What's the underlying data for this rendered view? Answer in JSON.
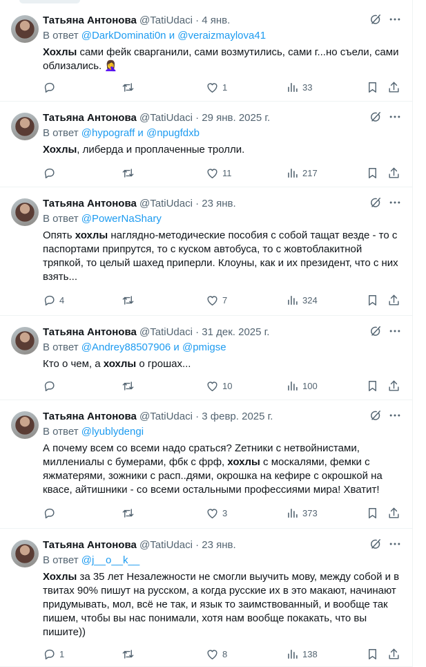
{
  "tweets": [
    {
      "name": "Татьяна Антонова",
      "handle": "@TatiUdaci",
      "dot": "·",
      "date": "4 янв.",
      "reply_prefix": "В ответ",
      "reply_to": [
        "@DarkDominati0n",
        "@veraizmaylova41"
      ],
      "reply_joiner": "и",
      "text_parts": [
        {
          "t": "Хохлы",
          "b": true
        },
        {
          "t": " сами фейк сварганили, сами возмутились, сами г...но съели, сами облизались. 🤦‍♀️",
          "b": false
        }
      ],
      "replies": "",
      "retweets": "",
      "likes": "1",
      "views": "33"
    },
    {
      "name": "Татьяна Антонова",
      "handle": "@TatiUdaci",
      "dot": "·",
      "date": "29 янв. 2025 г.",
      "reply_prefix": "В ответ",
      "reply_to": [
        "@hypograff",
        "@npugfdxb"
      ],
      "reply_joiner": "и",
      "text_parts": [
        {
          "t": "Хохлы",
          "b": true
        },
        {
          "t": ", либерда и проплаченные тролли.",
          "b": false
        }
      ],
      "replies": "",
      "retweets": "",
      "likes": "11",
      "views": "217"
    },
    {
      "name": "Татьяна Антонова",
      "handle": "@TatiUdaci",
      "dot": "·",
      "date": "23 янв.",
      "reply_prefix": "В ответ",
      "reply_to": [
        "@PowerNaShary"
      ],
      "reply_joiner": "",
      "text_parts": [
        {
          "t": "Опять ",
          "b": false
        },
        {
          "t": "хохлы",
          "b": true
        },
        {
          "t": " наглядно-методические пособия с собой тащат везде - то с паспортами припрутся, то с куском автобуса, то с жовтоблакитной тряпкой, то целый шахед приперли. Клоуны, как и их президент, что с них взять...",
          "b": false
        }
      ],
      "replies": "4",
      "retweets": "",
      "likes": "7",
      "views": "324"
    },
    {
      "name": "Татьяна Антонова",
      "handle": "@TatiUdaci",
      "dot": "·",
      "date": "31 дек. 2025 г.",
      "reply_prefix": "В ответ",
      "reply_to": [
        "@Andrey88507906",
        "@pmigse"
      ],
      "reply_joiner": "и",
      "text_parts": [
        {
          "t": "Кто о чем, а ",
          "b": false
        },
        {
          "t": "хохлы",
          "b": true
        },
        {
          "t": " о грошах...",
          "b": false
        }
      ],
      "replies": "",
      "retweets": "",
      "likes": "10",
      "views": "100"
    },
    {
      "name": "Татьяна Антонова",
      "handle": "@TatiUdaci",
      "dot": "·",
      "date": "3 февр. 2025 г.",
      "reply_prefix": "В ответ",
      "reply_to": [
        "@lyublydengi"
      ],
      "reply_joiner": "",
      "text_parts": [
        {
          "t": "А почему всем со всеми надо сраться? Zетники с нетвойнистами, миллениалы с бумерами, фбк с фрф, ",
          "b": false
        },
        {
          "t": "хохлы",
          "b": true
        },
        {
          "t": " с москалями, фемки с яжматерями, зожники с расп..дями, окрошка на кефире с окрошкой на квасе, айтишники - со всеми остальными профессиями мира! Хватит!",
          "b": false
        }
      ],
      "replies": "",
      "retweets": "",
      "likes": "3",
      "views": "373"
    },
    {
      "name": "Татьяна Антонова",
      "handle": "@TatiUdaci",
      "dot": "·",
      "date": "23 янв.",
      "reply_prefix": "В ответ",
      "reply_to": [
        "@j__o__k__"
      ],
      "reply_joiner": "",
      "text_parts": [
        {
          "t": "Хохлы",
          "b": true
        },
        {
          "t": " за 35 лет Незалежности не смогли выучить мову, между собой и в твитах 90% пишут на русском, а когда русские их в это макают, начинают придумывать, мол, всё не так, и язык то заимствованный, и вообще так пишем, чтобы вы нас понимали, хотя нам вообще покакать, что вы пишите))",
          "b": false
        }
      ],
      "replies": "1",
      "retweets": "",
      "likes": "8",
      "views": "138"
    }
  ],
  "icons": {
    "reply": "reply-icon",
    "retweet": "retweet-icon",
    "like": "heart-icon",
    "views": "views-icon",
    "bookmark": "bookmark-icon",
    "share": "share-icon",
    "grok": "grok-icon",
    "more": "more-icon"
  },
  "colors": {
    "text": "#0f1419",
    "secondary": "#536471",
    "link": "#1d9bf0",
    "border": "#eff3f4"
  }
}
